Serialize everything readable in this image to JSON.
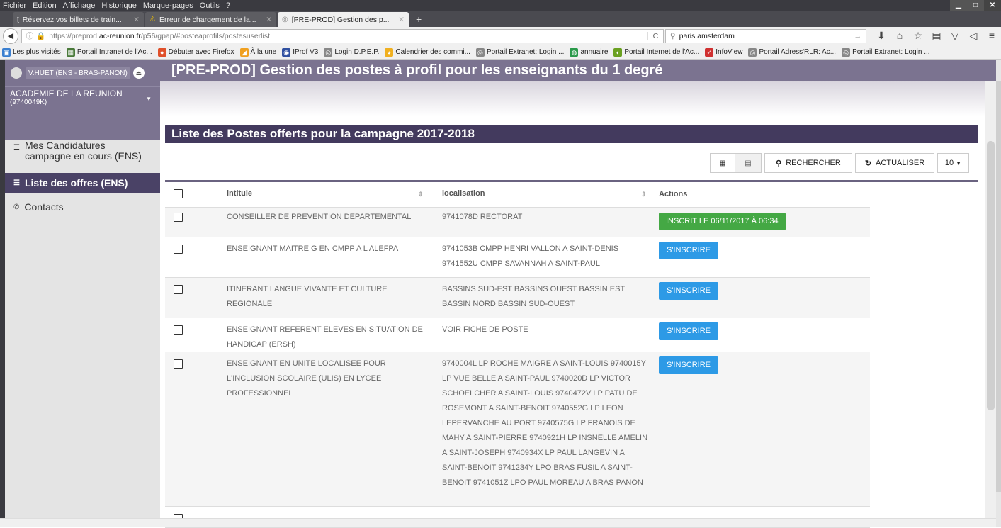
{
  "menubar": {
    "items": [
      "Fichier",
      "Edition",
      "Affichage",
      "Historique",
      "Marque-pages",
      "Outils",
      "?"
    ]
  },
  "tabs": [
    {
      "label": "Réservez vos billets de train...",
      "icon": "train-icon"
    },
    {
      "label": "Erreur de chargement de la...",
      "icon": "warning-icon"
    },
    {
      "label": "[PRE-PROD] Gestion des p...",
      "icon": "globe-icon"
    }
  ],
  "navbar": {
    "url_prefix": "https://preprod.",
    "url_domain": "ac-reunion.fr",
    "url_suffix": "/p56/gpap/#posteaprofils/postesuserlist",
    "search_value": "paris amsterdam"
  },
  "bookmarks": [
    "Les plus visités",
    "Portail Intranet de l'Ac...",
    "Débuter avec Firefox",
    "À la une",
    "IProf V3",
    "Login D.P.E.P.",
    "Calendrier des commi...",
    "Portail Extranet: Login ...",
    "annuaire",
    "Portail Internet de l'Ac...",
    "InfoView",
    "Portail Adress'RLR: Ac...",
    "Portail Extranet: Login ..."
  ],
  "sidebar": {
    "user": "V.HUET (ENS - BRAS-PANON)",
    "academy": "ACADEMIE DE LA REUNION",
    "academy_code": "(9740049K)",
    "menu": {
      "candidatures": "Mes Candidatures campagne en cours (ENS)",
      "offres": "Liste des offres (ENS)",
      "contacts": "Contacts"
    }
  },
  "header": {
    "title": "[PRE-PROD] Gestion des postes à profil pour les enseignants du 1 degré"
  },
  "list": {
    "title": "Liste des Postes offerts pour la campagne 2017-2018",
    "toolbar": {
      "search": "RECHERCHER",
      "refresh": "ACTUALISER",
      "page_size": "10"
    },
    "columns": {
      "intitule": "intitule",
      "localisation": "localisation",
      "actions": "Actions"
    },
    "rows": [
      {
        "intitule": "CONSEILLER DE PREVENTION DEPARTEMENTAL",
        "localisation": "9741078D RECTORAT",
        "action": "INSCRIT LE 06/11/2017 À 06:34",
        "status": "registered"
      },
      {
        "intitule": "ENSEIGNANT MAITRE G EN CMPP A L ALEFPA",
        "localisation": "9741053B CMPP HENRI VALLON A SAINT-DENIS 9741552U CMPP SAVANNAH A SAINT-PAUL",
        "action": "S'INSCRIRE",
        "status": "open"
      },
      {
        "intitule": "ITINERANT LANGUE VIVANTE ET CULTURE REGIONALE",
        "localisation": "BASSINS SUD-EST BASSINS OUEST BASSIN EST BASSIN NORD BASSIN SUD-OUEST",
        "action": "S'INSCRIRE",
        "status": "open"
      },
      {
        "intitule": "ENSEIGNANT REFERENT ELEVES EN SITUATION DE HANDICAP (ERSH)",
        "localisation": "VOIR FICHE DE POSTE",
        "action": "S'INSCRIRE",
        "status": "open"
      },
      {
        "intitule": "ENSEIGNANT EN UNITE LOCALISEE POUR L'INCLUSION SCOLAIRE (ULIS) EN LYCEE PROFESSIONNEL",
        "localisation": "9740004L LP ROCHE MAIGRE A SAINT-LOUIS 9740015Y LP VUE BELLE A SAINT-PAUL 9740020D LP VICTOR SCHOELCHER A SAINT-LOUIS 9740472V LP PATU DE ROSEMONT A SAINT-BENOIT 9740552G LP LEON LEPERVANCHE AU PORT 9740575G LP FRANOIS DE MAHY A SAINT-PIERRE 9740921H LP INSNELLE AMELIN A SAINT-JOSEPH 9740934X LP PAUL LANGEVIN A SAINT-BENOIT 9741234Y LPO BRAS FUSIL A SAINT-BENOIT 9741051Z LPO PAUL MOREAU A BRAS PANON",
        "action": "S'INSCRIRE",
        "status": "open"
      }
    ]
  },
  "colors": {
    "sidebar_top": "#7b7390",
    "active_menu": "#4a4266",
    "title_bar": "#433a5e",
    "btn_blue": "#2d9ae6",
    "btn_green": "#44a844"
  }
}
